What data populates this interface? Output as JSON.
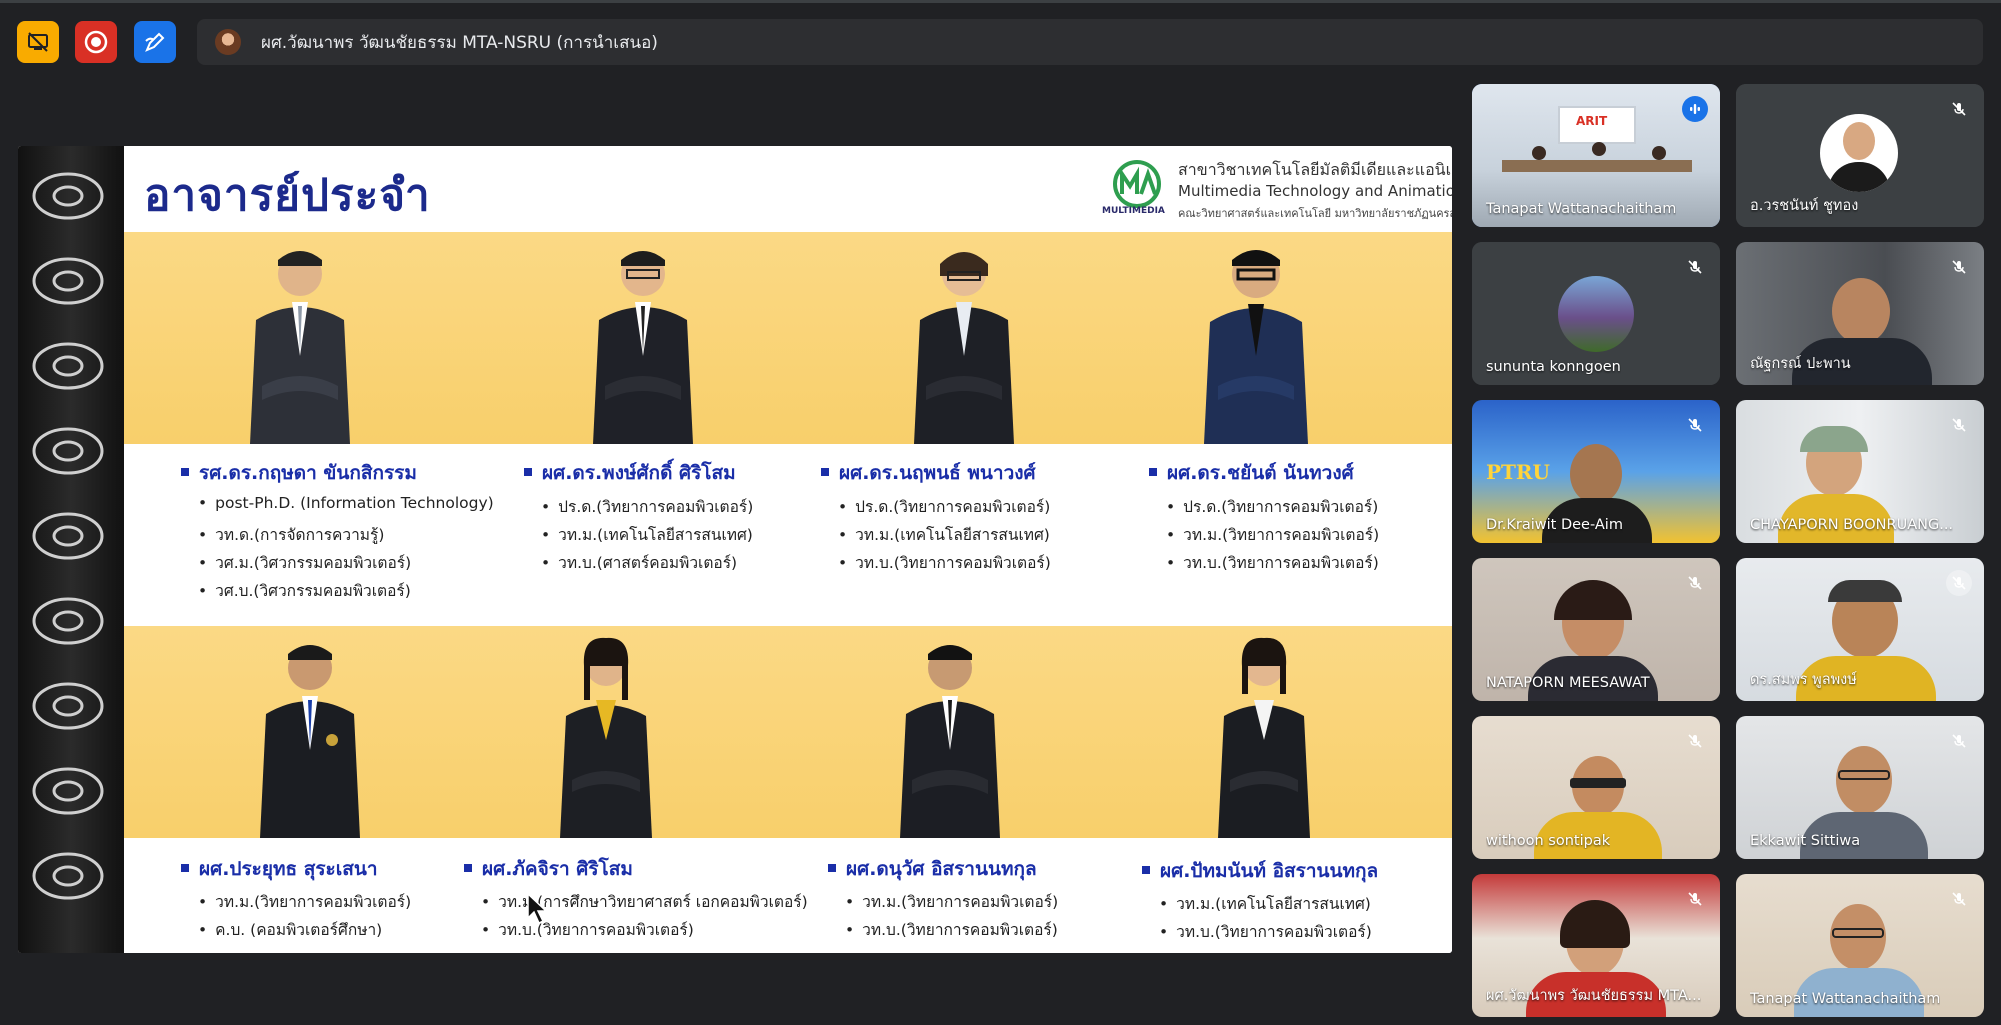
{
  "meeting": {
    "presenter_label": "ผศ.วัฒนาพร วัฒนชัยธรรม MTA-NSRU (การนำเสนอ)",
    "controls": [
      {
        "name": "stop-sharing-icon",
        "color": "#f9ab00"
      },
      {
        "name": "record-icon",
        "color": "#d93025"
      },
      {
        "name": "annotate-icon",
        "color": "#1a73e8"
      }
    ]
  },
  "slide": {
    "title": "อาจารย์ประจำ",
    "logo_text": "MULTIMEDIA",
    "dept_th": "สาขาวิชาเทคโนโลยีมัลติมีเดียและแอนิเมชัน",
    "dept_en": "Multimedia Technology and Animation",
    "faculty": "คณะวิทยาศาสตร์และเทคโนโลยี มหาวิทยาลัยราชภัฏนครสวรรค์",
    "row1": [
      {
        "name": "รศ.ดร.กฤษดา ขันกสิกรรม",
        "degrees": [
          "post-Ph.D. (Information Technology)",
          "วท.ด.(การจัดการความรู้)",
          "วศ.ม.(วิศวกรรมคอมพิวเตอร์)",
          "วศ.บ.(วิศวกรรมคอมพิวเตอร์)"
        ]
      },
      {
        "name": "ผศ.ดร.พงษ์ศักดิ์ ศิริโสม",
        "degrees": [
          "ปร.ด.(วิทยาการคอมพิวเตอร์)",
          "วท.ม.(เทคโนโลยีสารสนเทศ)",
          "วท.บ.(ศาสตร์คอมพิวเตอร์)"
        ]
      },
      {
        "name": "ผศ.ดร.นฤพนธ์ พนาวงศ์",
        "degrees": [
          "ปร.ด.(วิทยาการคอมพิวเตอร์)",
          "วท.ม.(เทคโนโลยีสารสนเทศ)",
          "วท.บ.(วิทยาการคอมพิวเตอร์)"
        ]
      },
      {
        "name": "ผศ.ดร.ชยันต์ นันทวงศ์",
        "degrees": [
          "ปร.ด.(วิทยาการคอมพิวเตอร์)",
          "วท.ม.(วิทยาการคอมพิวเตอร์)",
          "วท.บ.(วิทยาการคอมพิวเตอร์)"
        ]
      }
    ],
    "row2": [
      {
        "name": "ผศ.ประยุทธ สุระเสนา",
        "degrees": [
          "วท.ม.(วิทยาการคอมพิวเตอร์)",
          "ค.บ. (คอมพิวเตอร์ศึกษา)"
        ]
      },
      {
        "name": "ผศ.ภัคจิรา ศิริโสม",
        "degrees": [
          "วท.ม.(การศึกษาวิทยาศาสตร์ เอกคอมพิวเตอร์)",
          "วท.บ.(วิทยาการคอมพิวเตอร์)"
        ]
      },
      {
        "name": "ผศ.ดนุวัศ อิสรานนทกุล",
        "degrees": [
          "วท.ม.(วิทยาการคอมพิวเตอร์)",
          "วท.บ.(วิทยาการคอมพิวเตอร์)"
        ]
      },
      {
        "name": "ผศ.ปัทมนันท์ อิสรานนทกุล",
        "degrees": [
          "วท.ม.(เทคโนโลยีสารสนเทศ)",
          "วท.บ.(วิทยาการคอมพิวเตอร์)"
        ]
      }
    ]
  },
  "participants": [
    {
      "name": "Tanapat Wattanachaitham",
      "speaking": true
    },
    {
      "name": "อ.วรชนันท์ ชูทอง",
      "speaking": false
    },
    {
      "name": "sununta konngoen",
      "speaking": false
    },
    {
      "name": "ณัฐกรณ์ ปะพาน",
      "speaking": false
    },
    {
      "name": "Dr.Kraiwit Dee-Aim",
      "speaking": false
    },
    {
      "name": "CHAYAPORN BOONRUANG...",
      "speaking": false
    },
    {
      "name": "NATAPORN MEESAWAT",
      "speaking": false
    },
    {
      "name": "ดร.สมพร พูลพงษ์",
      "speaking": false
    },
    {
      "name": "withoon sontipak",
      "speaking": false
    },
    {
      "name": "Ekkawit Sittiwa",
      "speaking": false
    },
    {
      "name": "ผศ.วัฒนาพร วัฒนชัยธรรม MTA...",
      "speaking": false
    },
    {
      "name": "Tanapat Wattanachaitham",
      "speaking": false
    }
  ]
}
